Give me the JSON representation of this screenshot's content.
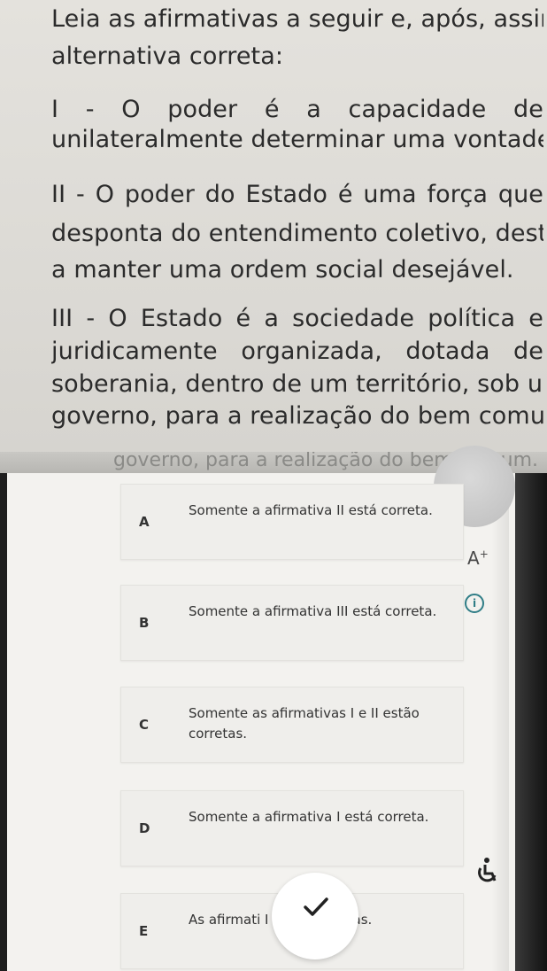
{
  "question": {
    "lines": [
      "Leia as afirmativas a seguir e, após, assinale a",
      "alternativa correta:",
      "I - O poder é a capacidade de",
      "unilateralmente determinar uma vontade.",
      "II - O poder do Estado é uma força que",
      "desponta do entendimento coletivo, destinada",
      "a manter uma ordem social desejável.",
      "III - O Estado é a sociedade política e",
      "juridicamente organizada, dotada de",
      "soberania, dentro de um território, sob um",
      "governo, para a realização do bem comum."
    ],
    "partial_repeat": "governo, para a realização do bem comum."
  },
  "options": [
    {
      "letter": "A",
      "text": "Somente a afirmativa II está correta."
    },
    {
      "letter": "B",
      "text": "Somente a afirmativa III está correta."
    },
    {
      "letter": "C",
      "text": "Somente as afirmativas I e II estão corretas."
    },
    {
      "letter": "D",
      "text": "Somente a afirmativa I está correta."
    },
    {
      "letter": "E",
      "text": "As afirmati        I estão corretas."
    }
  ],
  "toolbar": {
    "font_size_label": "A",
    "font_size_sup": "+",
    "info_label": "i"
  },
  "colors": {
    "info_accent": "#2f7d86",
    "check_mark": "#222222"
  }
}
